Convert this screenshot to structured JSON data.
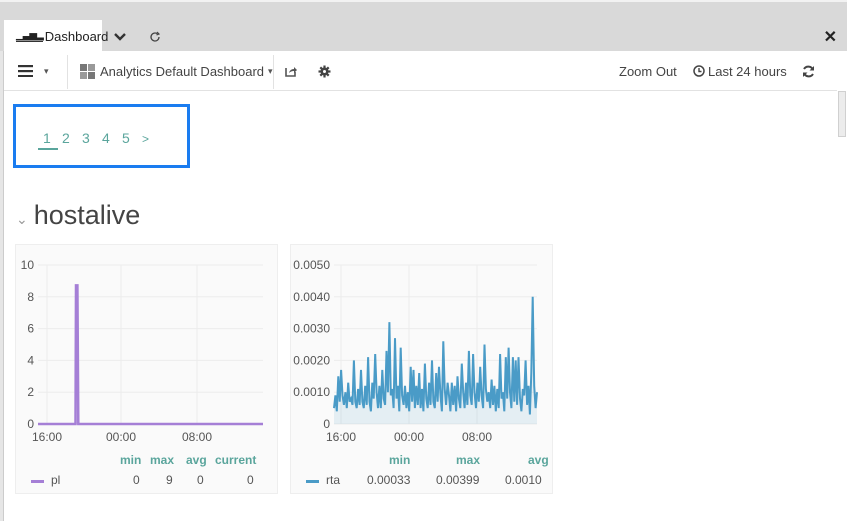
{
  "tabbar": {
    "active_tab": "Dashboard",
    "active_tab_icon": "bar-chart-icon",
    "dropdown_icon": "chevron-down-icon",
    "reload_icon": "reload-icon",
    "close_icon": "close-icon"
  },
  "toolbar": {
    "menu_icon": "hamburger-icon",
    "menu_caret": "▾",
    "dashboard_icon": "grid-icon",
    "dashboard_name": "Analytics Default Dashboard",
    "dashboard_caret": "▾",
    "share_icon": "share-icon",
    "settings_icon": "gear-icon",
    "zoom_out": "Zoom Out",
    "time_icon": "clock-icon",
    "time_range": "Last 24 hours",
    "refresh_icon": "refresh-icon"
  },
  "pager": {
    "pages": [
      "1",
      "2",
      "3",
      "4",
      "5"
    ],
    "next": ">",
    "active": "1"
  },
  "section": {
    "title": "hostalive",
    "collapse_icon": "chevron-down-icon"
  },
  "chart_data": [
    {
      "type": "line",
      "title": "",
      "xlabel": "",
      "ylabel": "",
      "ylim": [
        0,
        10
      ],
      "yticks": [
        "10",
        "8",
        "6",
        "4",
        "2",
        "0"
      ],
      "xticks": [
        "16:00",
        "00:00",
        "08:00"
      ],
      "grid": true,
      "color": "#a57fd6",
      "series": [
        {
          "name": "pl",
          "x_hours_from_start": [
            0,
            4.0,
            4.05,
            4.1,
            4.2,
            4.3,
            24
          ],
          "values": [
            0,
            0,
            8.8,
            5,
            8.8,
            0,
            0
          ]
        }
      ],
      "legend": {
        "columns": [
          "min",
          "max",
          "avg",
          "current"
        ],
        "rows": [
          {
            "name": "pl",
            "min": "0",
            "max": "9",
            "avg": "0",
            "current": "0"
          }
        ]
      }
    },
    {
      "type": "area",
      "title": "",
      "xlabel": "",
      "ylabel": "",
      "ylim": [
        0,
        0.005
      ],
      "yticks": [
        "0.0050",
        "0.0040",
        "0.0030",
        "0.0020",
        "0.0010",
        "0"
      ],
      "xticks": [
        "16:00",
        "00:00",
        "08:00"
      ],
      "grid": true,
      "color": "#4a9bc7",
      "series": [
        {
          "name": "rta",
          "values": [
            0.0005,
            0.0009,
            0.0004,
            0.0015,
            0.0007,
            0.0017,
            0.0009,
            0.0006,
            0.001,
            0.0005,
            0.0013,
            0.0007,
            0.0008,
            0.0006,
            0.002,
            0.0007,
            0.0005,
            0.0011,
            0.0006,
            0.0017,
            0.0007,
            0.0005,
            0.0012,
            0.0006,
            0.0021,
            0.0007,
            0.0004,
            0.0013,
            0.0008,
            0.0022,
            0.001,
            0.0005,
            0.0012,
            0.0005,
            0.0017,
            0.0008,
            0.0006,
            0.0023,
            0.001,
            0.0032,
            0.0009,
            0.0011,
            0.0005,
            0.0027,
            0.0008,
            0.0012,
            0.0004,
            0.0024,
            0.0009,
            0.0006,
            0.0012,
            0.0005,
            0.001,
            0.0004,
            0.0018,
            0.0007,
            0.0017,
            0.0005,
            0.0012,
            0.0006,
            0.0016,
            0.0005,
            0.0011,
            0.0004,
            0.0019,
            0.0008,
            0.0005,
            0.0013,
            0.0006,
            0.002,
            0.0007,
            0.0005,
            0.0016,
            0.0007,
            0.0018,
            0.0009,
            0.0004,
            0.0026,
            0.0011,
            0.0006,
            0.0013,
            0.0009,
            0.0004,
            0.0013,
            0.0006,
            0.0012,
            0.0004,
            0.0015,
            0.0008,
            0.0005,
            0.0019,
            0.001,
            0.0005,
            0.0013,
            0.0006,
            0.0023,
            0.0009,
            0.0006,
            0.0022,
            0.001,
            0.0005,
            0.0013,
            0.0007,
            0.0018,
            0.0009,
            0.0005,
            0.0025,
            0.0011,
            0.0007,
            0.001,
            0.0005,
            0.0014,
            0.0006,
            0.0012,
            0.0004,
            0.0011,
            0.0005,
            0.0022,
            0.0008,
            0.001,
            0.0004,
            0.0021,
            0.0008,
            0.0024,
            0.001,
            0.0005,
            0.0021,
            0.0007,
            0.002,
            0.0006,
            0.0021,
            0.0008,
            0.0004,
            0.0011,
            0.0009,
            0.002,
            0.0006,
            0.0012,
            0.0003,
            0.0016,
            0.004,
            0.0012,
            0.0005,
            0.001
          ]
        }
      ],
      "legend": {
        "columns": [
          "min",
          "max",
          "avg"
        ],
        "rows": [
          {
            "name": "rta",
            "min": "0.00033",
            "max": "0.00399",
            "avg": "0.0010"
          }
        ]
      }
    }
  ]
}
